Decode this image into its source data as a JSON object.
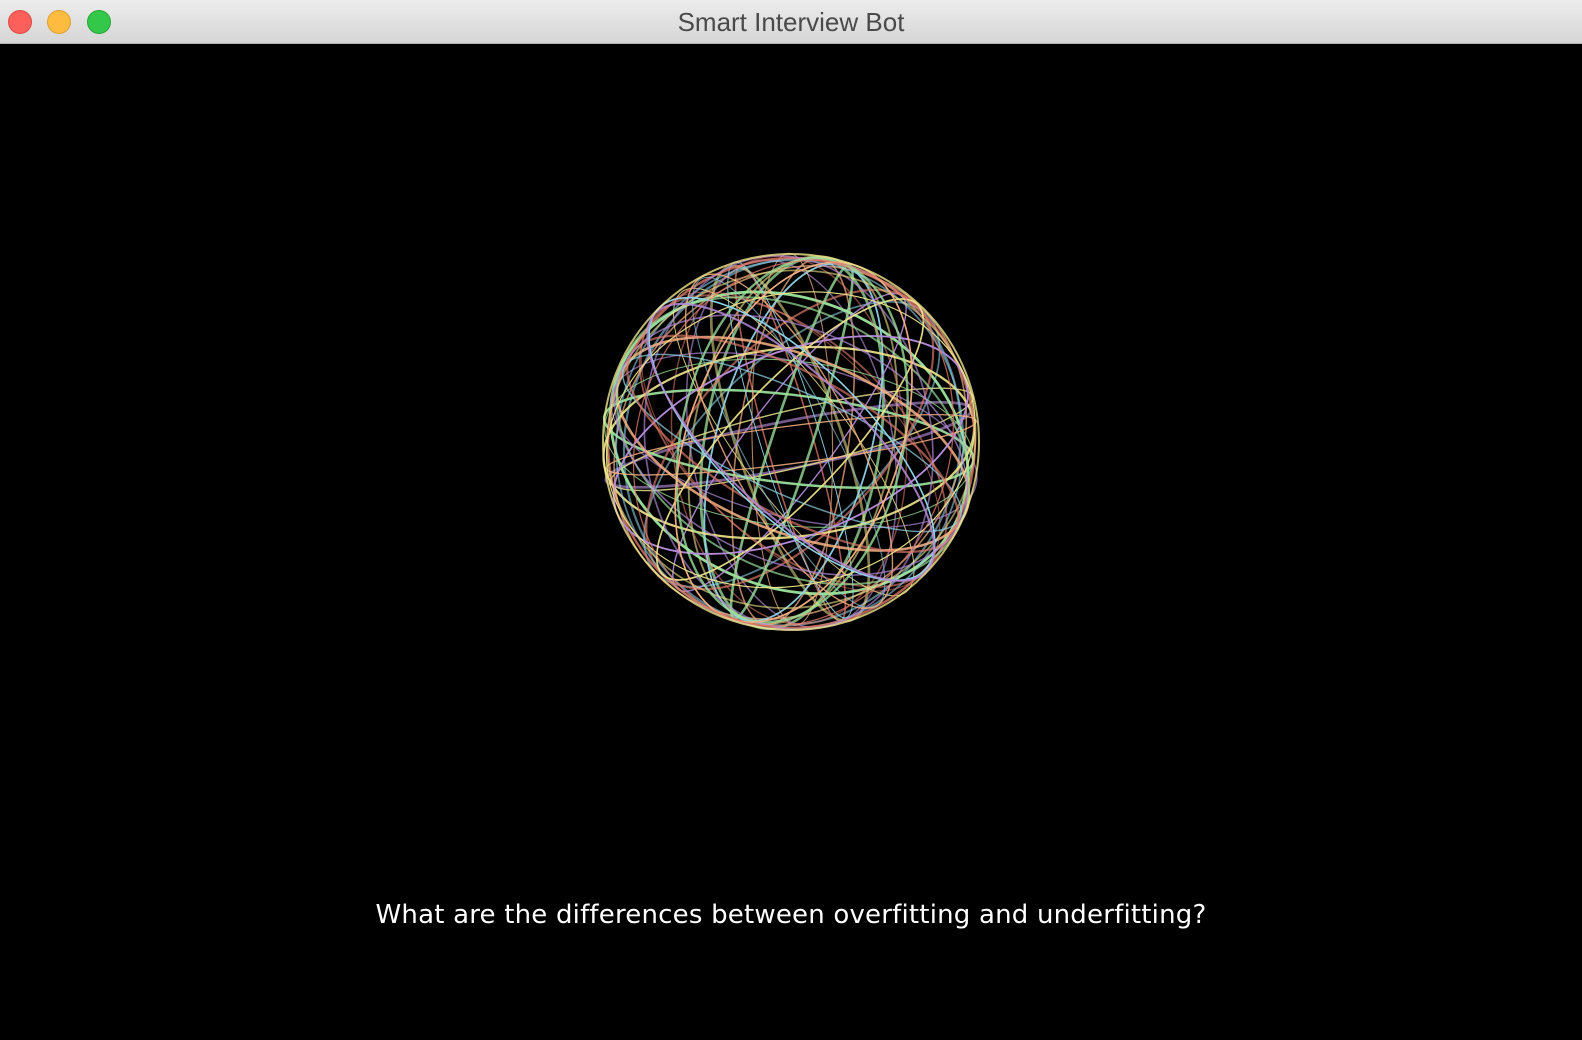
{
  "window": {
    "title": "Smart Interview Bot",
    "traffic_lights": {
      "close": {
        "icon": "close-icon",
        "color": "#fc605b"
      },
      "minimize": {
        "icon": "minimize-icon",
        "color": "#fdbc40"
      },
      "zoom": {
        "icon": "zoom-icon",
        "color": "#34c84a"
      }
    }
  },
  "main": {
    "background": "#000000",
    "visualizer": {
      "icon": "wireframe-sphere-icon",
      "colors": [
        "#f0e68c",
        "#8fd3e8",
        "#e07a6a",
        "#b48ad8",
        "#9be09b",
        "#f4b183"
      ]
    },
    "question": "What are the differences between overfitting and underfitting?"
  }
}
